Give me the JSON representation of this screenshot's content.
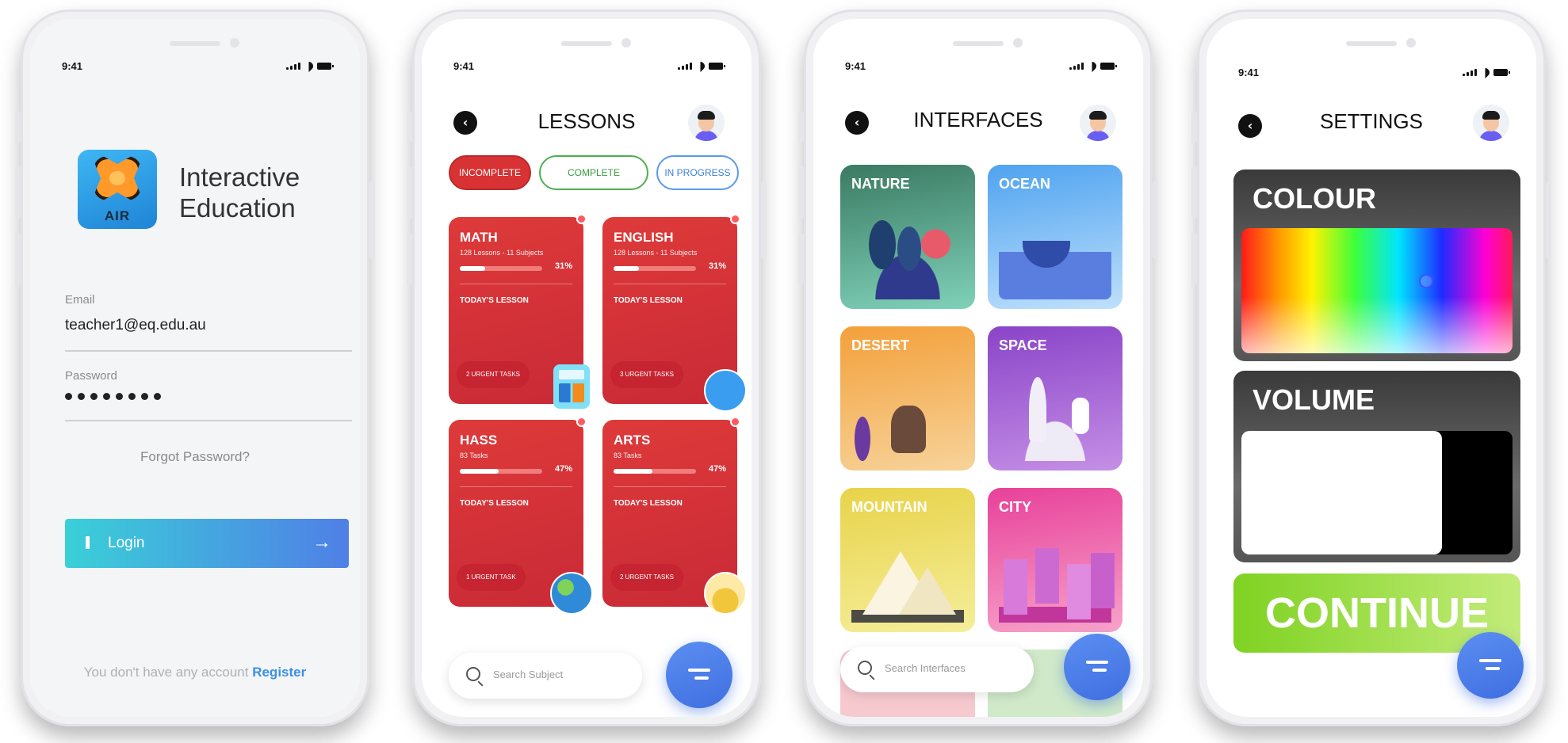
{
  "status_time": "9:41",
  "login": {
    "logo_text": "AIR",
    "brand_line1": "Interactive",
    "brand_line2": "Education",
    "email_label": "Email",
    "email_value": "teacher1@eq.edu.au",
    "password_label": "Password",
    "forgot": "Forgot Password?",
    "login_button": "Login",
    "no_account": "You don't have any account ",
    "register": "Register"
  },
  "lessons": {
    "title": "LESSONS",
    "filters": [
      "INCOMPLETE",
      "COMPLETE",
      "IN PROGRESS"
    ],
    "today_label": "TODAY'S LESSON",
    "search_placeholder": "Search Subject",
    "cards": [
      {
        "name": "MATH",
        "meta": "128 Lessons - 11 Subjects",
        "progress": 31,
        "progress_label": "31%",
        "urgent": "2 URGENT TASKS"
      },
      {
        "name": "ENGLISH",
        "meta": "128 Lessons - 11 Subjects",
        "progress": 31,
        "progress_label": "31%",
        "urgent": "3 URGENT TASKS"
      },
      {
        "name": "HASS",
        "meta": "83 Tasks",
        "progress": 47,
        "progress_label": "47%",
        "urgent": "1 URGENT TASK"
      },
      {
        "name": "ARTS",
        "meta": "83 Tasks",
        "progress": 47,
        "progress_label": "47%",
        "urgent": "2 URGENT TASKS"
      }
    ]
  },
  "interfaces": {
    "title": "INTERFACES",
    "tiles": [
      "NATURE",
      "OCEAN",
      "DESERT",
      "SPACE",
      "MOUNTAIN",
      "CITY"
    ],
    "search_placeholder": "Search Interfaces"
  },
  "settings": {
    "title": "SETTINGS",
    "colour_label": "COLOUR",
    "volume_label": "VOLUME",
    "volume_level": 0.74,
    "continue": "CONTINUE"
  },
  "colors": {
    "lesson_red": "#d83234",
    "complete_green": "#4caf50",
    "progress_blue": "#3b7fdc",
    "fab_blue": "#4f7fe6",
    "continue_green": "#7fd222"
  }
}
